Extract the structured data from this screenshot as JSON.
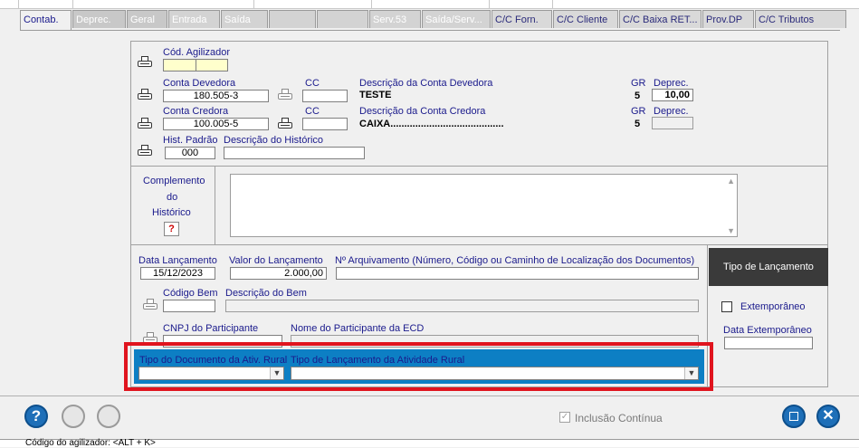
{
  "tabs": [
    {
      "label": "Contab.",
      "state": "active"
    },
    {
      "label": "Deprec.",
      "state": "gray"
    },
    {
      "label": "Geral",
      "state": "gray"
    },
    {
      "label": "Entrada",
      "state": "lite"
    },
    {
      "label": "Saída",
      "state": "lite"
    },
    {
      "label": "",
      "state": "lite"
    },
    {
      "label": "",
      "state": "lite"
    },
    {
      "label": "Serv.53",
      "state": "lite"
    },
    {
      "label": "Saída/Serv...",
      "state": "lite"
    },
    {
      "label": "C/C Forn.",
      "state": "enab"
    },
    {
      "label": "C/C Cliente",
      "state": "enab"
    },
    {
      "label": "C/C Baixa RET...",
      "state": "enab"
    },
    {
      "label": "Prov.DP",
      "state": "enab"
    },
    {
      "label": "C/C Tributos",
      "state": "enab"
    }
  ],
  "form": {
    "cod_agilizador_label": "Cód. Agilizador",
    "conta_devedora_label": "Conta Devedora",
    "conta_devedora_value": "180.505-3",
    "cc_label": "CC",
    "desc_devedora_label": "Descrição da Conta Devedora",
    "desc_devedora_value": "TESTE",
    "gr_label": "GR",
    "gr_devedora_value": "5",
    "deprec_label": "Deprec.",
    "deprec_devedora_value": "10,00",
    "conta_credora_label": "Conta Credora",
    "conta_credora_value": "100.005-5",
    "desc_credora_label": "Descrição da Conta Credora",
    "desc_credora_value": "CAIXA.........................................",
    "gr_credora_value": "5",
    "hist_padrao_label": "Hist. Padrão",
    "hist_padrao_value": "000",
    "desc_historico_label": "Descrição do Histórico",
    "complemento_l1": "Complemento",
    "complemento_l2": "do",
    "complemento_l3": "Histórico",
    "help_glyph": "?",
    "data_lancamento_label": "Data Lançamento",
    "data_lancamento_value": "15/12/2023",
    "valor_lancamento_label": "Valor do Lançamento",
    "valor_lancamento_value": "2.000,00",
    "arquivamento_label": "Nº Arquivamento (Número, Código ou Caminho de Localização dos Documentos)",
    "codigo_bem_label": "Código Bem",
    "descricao_bem_label": "Descrição do Bem",
    "cnpj_participante_label": "CNPJ do Participante",
    "nome_participante_label": "Nome do Participante da ECD",
    "tipo_lancamento_title": "Tipo de Lançamento",
    "extemporaneo_label": "Extemporâneo",
    "data_extemporaneo_label": "Data Extemporâneo",
    "tipo_doc_rural_label": "Tipo do Documento da Ativ. Rural",
    "tipo_lanc_rural_label": "Tipo de Lançamento da Atividade Rural"
  },
  "bottom": {
    "inclusao_continua_label": "Inclusão Contínua"
  },
  "statusbar": {
    "text": "Código do agilizador: <ALT + K>"
  },
  "colors": {
    "highlight_frame": "#e0141e",
    "rural_section": "#0d7fc4",
    "label_text": "#1a1a8c"
  }
}
